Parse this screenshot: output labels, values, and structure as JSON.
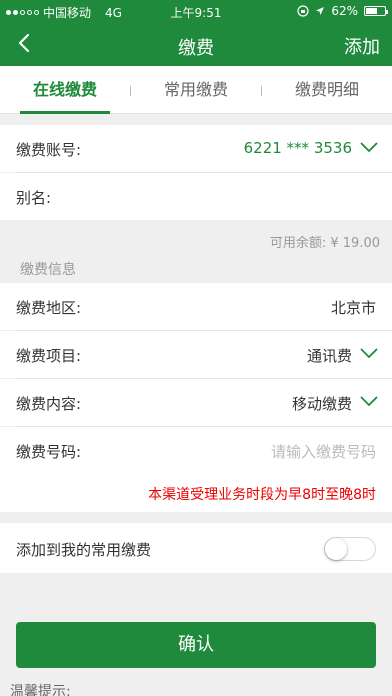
{
  "status_bar": {
    "carrier": "中国移动",
    "network": "4G",
    "time": "上午9:51",
    "battery": "62%",
    "battery_level": 0.62
  },
  "nav": {
    "back_icon": "chevron-left-icon",
    "title": "缴费",
    "action": "添加"
  },
  "tabs": [
    {
      "label": "在线缴费",
      "active": true
    },
    {
      "label": "常用缴费",
      "active": false
    },
    {
      "label": "缴费明细",
      "active": false
    }
  ],
  "account": {
    "label": "缴费账号:",
    "value": "6221 *** 3536"
  },
  "alias": {
    "label": "别名:",
    "value": ""
  },
  "balance": "可用余额: ¥ 19.00",
  "section_title": "缴费信息",
  "fields": {
    "region": {
      "label": "缴费地区:",
      "value": "北京市"
    },
    "item": {
      "label": "缴费项目:",
      "value": "通讯费"
    },
    "content": {
      "label": "缴费内容:",
      "value": "移动缴费"
    },
    "number": {
      "label": "缴费号码:",
      "placeholder": "请输入缴费号码"
    }
  },
  "notice": "本渠道受理业务时段为早8时至晚8时",
  "favorite": {
    "label": "添加到我的常用缴费",
    "enabled": false
  },
  "confirm_button": "确认",
  "tips_label": "温馨提示:",
  "colors": {
    "brand_green": "#1f8a3c",
    "notice_red": "#e00000",
    "background": "#efefef"
  }
}
